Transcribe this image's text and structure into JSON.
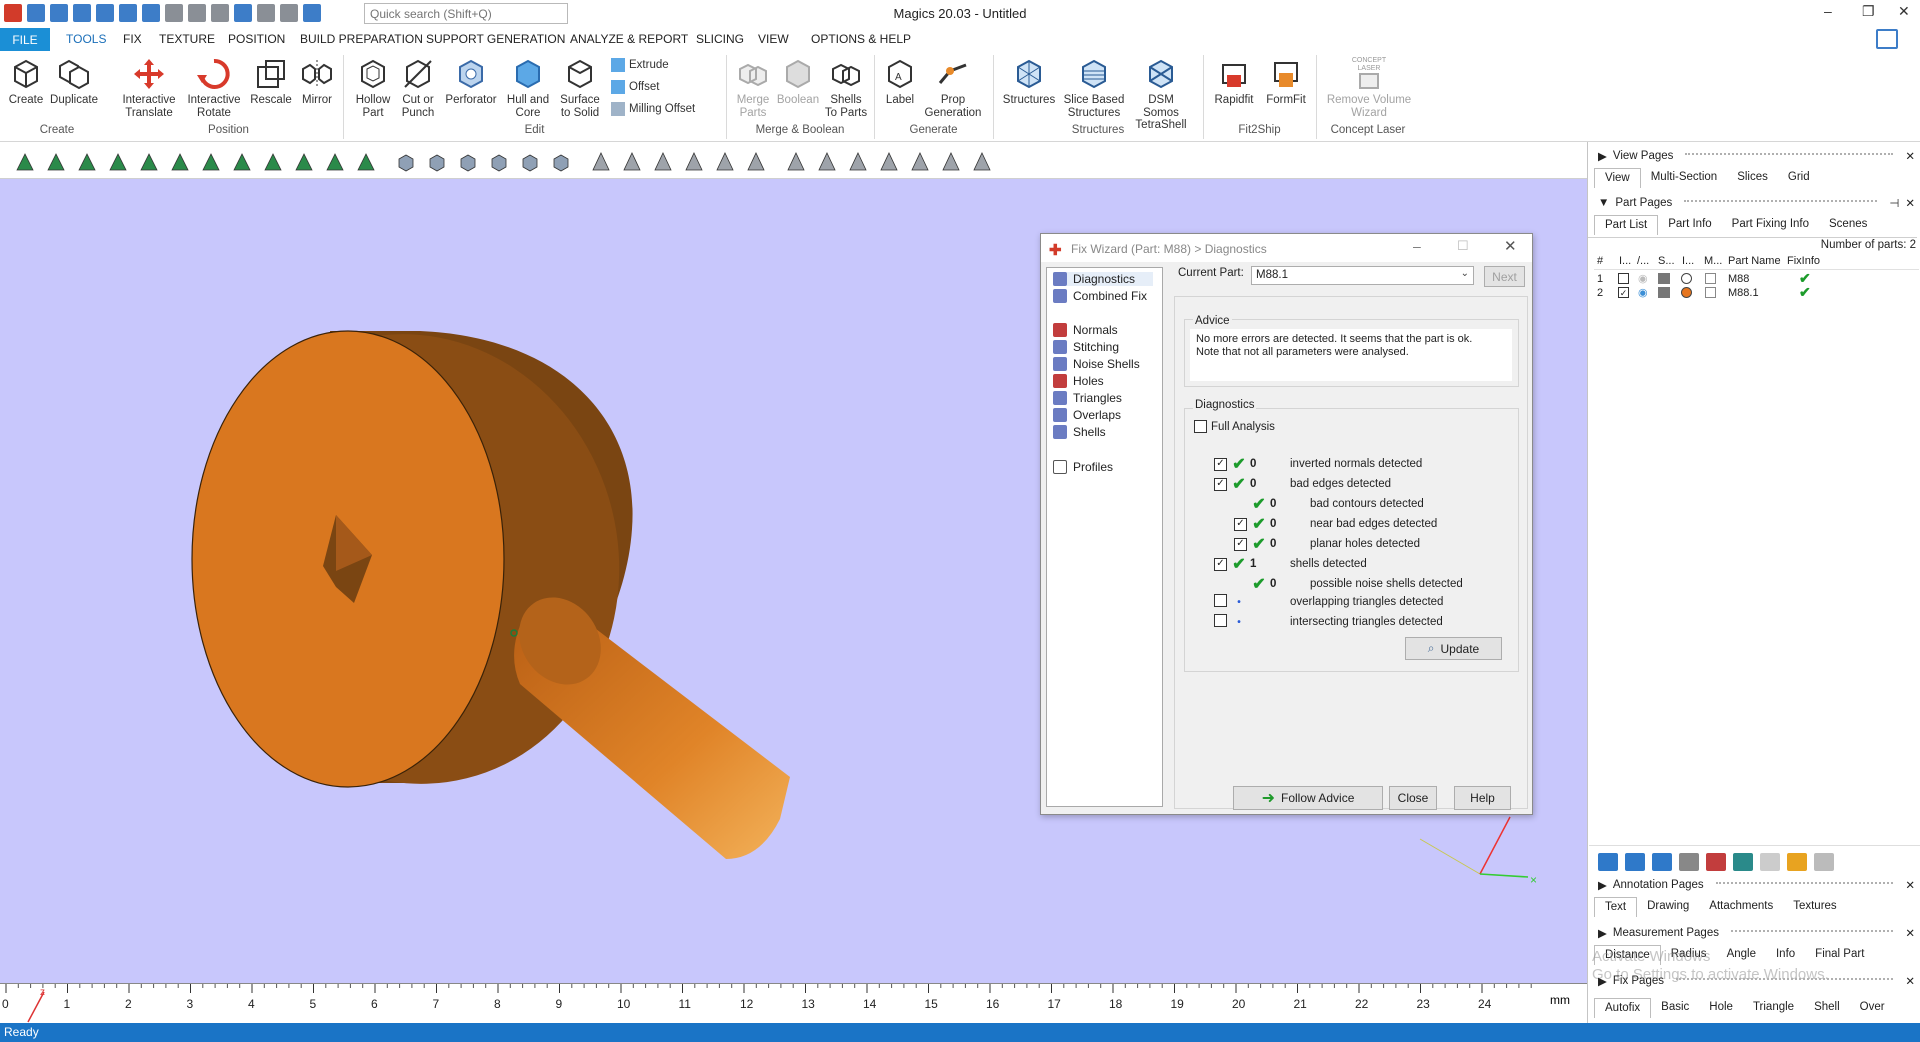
{
  "app": {
    "title": "Magics 20.03 - Untitled",
    "quick_search_placeholder": "Quick search (Shift+Q)"
  },
  "menu": {
    "file": "FILE",
    "items": [
      "TOOLS",
      "FIX",
      "TEXTURE",
      "POSITION",
      "BUILD PREPARATION",
      "SUPPORT GENERATION",
      "ANALYZE & REPORT",
      "SLICING",
      "VIEW",
      "OPTIONS & HELP"
    ]
  },
  "ribbon": {
    "buttons": [
      "Create",
      "Duplicate",
      "Interactive\nTranslate",
      "Interactive\nRotate",
      "Rescale",
      "Mirror",
      "Hollow\nPart",
      "Cut or\nPunch",
      "Perforator",
      "Hull and\nCore",
      "Surface\nto Solid",
      "Merge\nParts",
      "Boolean",
      "Shells\nTo Parts",
      "Label",
      "Prop\nGeneration",
      "Structures",
      "Slice Based\nStructures",
      "DSM Somos\nTetraShell",
      "Rapidfit",
      "FormFit",
      "Remove Volume\nWizard"
    ],
    "small_buttons": [
      "Extrude",
      "Offset",
      "Milling Offset"
    ],
    "groups": [
      "Create",
      "Position",
      "Edit",
      "Merge & Boolean",
      "Generate",
      "Structures",
      "Fit2Ship",
      "Concept Laser"
    ],
    "concept_laser_logo": "CONCEPT\nLASER"
  },
  "status": {
    "text": "Ready"
  },
  "ruler": {
    "ticks": [
      "0",
      "1",
      "2",
      "3",
      "4",
      "5",
      "6",
      "7",
      "8",
      "9",
      "10",
      "11",
      "12",
      "13",
      "14",
      "15",
      "16",
      "17",
      "18",
      "19",
      "20",
      "21",
      "22",
      "23",
      "24"
    ],
    "unit": "mm",
    "axis_label": "z"
  },
  "dialog": {
    "title": "Fix Wizard (Part: M88) > Diagnostics",
    "nav": {
      "top": [
        "Diagnostics",
        "Combined Fix"
      ],
      "mid": [
        "Normals",
        "Stitching",
        "Noise Shells",
        "Holes",
        "Triangles",
        "Overlaps",
        "Shells"
      ],
      "bottom": [
        "Profiles"
      ]
    },
    "current_part_label": "Current Part:",
    "current_part_value": "M88.1",
    "next_label": "Next",
    "advice_label": "Advice",
    "advice_text": "No more errors are detected. It seems that the part is ok.\nNote that not all parameters were analysed.",
    "diagnostics_label": "Diagnostics",
    "full_analysis_label": "Full Analysis",
    "rows": [
      {
        "checked": true,
        "status": "ok",
        "value": "0",
        "label": "inverted normals detected",
        "indent": 0
      },
      {
        "checked": true,
        "status": "ok",
        "value": "0",
        "label": "bad edges detected",
        "indent": 0
      },
      {
        "checked": null,
        "status": "ok",
        "value": "0",
        "label": "bad contours detected",
        "indent": 1
      },
      {
        "checked": true,
        "status": "ok",
        "value": "0",
        "label": "near bad edges detected",
        "indent": 1
      },
      {
        "checked": true,
        "status": "ok",
        "value": "0",
        "label": "planar holes detected",
        "indent": 1
      },
      {
        "checked": true,
        "status": "ok",
        "value": "1",
        "label": "shells detected",
        "indent": 0
      },
      {
        "checked": null,
        "status": "ok",
        "value": "0",
        "label": "possible noise shells detected",
        "indent": 1
      },
      {
        "checked": false,
        "status": "none",
        "value": "",
        "label": "overlapping triangles detected",
        "indent": 0
      },
      {
        "checked": false,
        "status": "none",
        "value": "",
        "label": "intersecting triangles detected",
        "indent": 0
      }
    ],
    "update_label": "Update",
    "follow_advice_label": "Follow Advice",
    "close_label": "Close",
    "help_label": "Help"
  },
  "right_panel": {
    "view_pages": "View Pages",
    "view_tabs": [
      "View",
      "Multi-Section",
      "Slices",
      "Grid"
    ],
    "part_pages": "Part Pages",
    "part_tabs": [
      "Part List",
      "Part Info",
      "Part Fixing Info",
      "Scenes"
    ],
    "num_parts": "Number of parts: 2",
    "columns": [
      "#",
      "I...",
      "/...",
      "S...",
      "I...",
      "M...",
      "Part Name",
      "FixInfo"
    ],
    "parts": [
      {
        "num": "1",
        "name": "M88",
        "checked": false,
        "color": "#ffffff"
      },
      {
        "num": "2",
        "name": "M88.1",
        "checked": true,
        "color": "#e6751e"
      }
    ],
    "annotation_pages": "Annotation Pages",
    "annotation_tabs": [
      "Text",
      "Drawing",
      "Attachments",
      "Textures"
    ],
    "measurement_pages": "Measurement Pages",
    "measurement_tabs": [
      "Distance",
      "Radius",
      "Angle",
      "Info",
      "Final Part"
    ],
    "fix_pages": "Fix Pages",
    "fix_tabs": [
      "Autofix",
      "Basic",
      "Hole",
      "Triangle",
      "Shell",
      "Over"
    ],
    "watermark": "Activate Windows\nGo to Settings to activate Windows."
  },
  "colors": {
    "viewport_bg": "#c8c7fc",
    "part": "#d9771f",
    "accent": "#1b8fd6",
    "check": "#1c9b2b"
  }
}
